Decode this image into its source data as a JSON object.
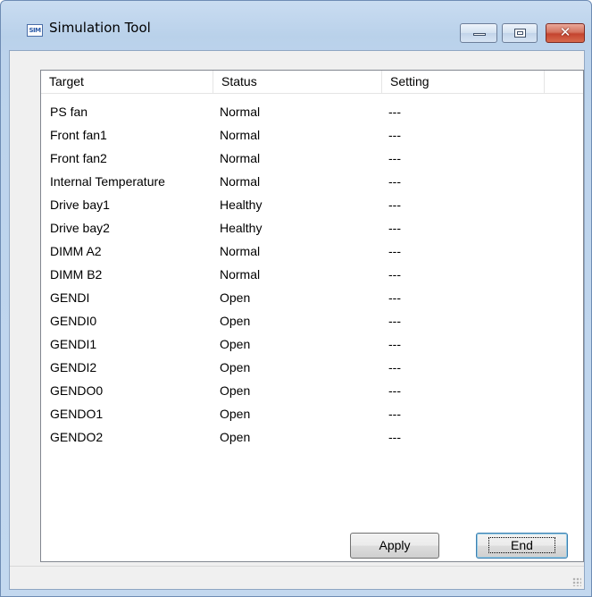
{
  "window": {
    "title": "Simulation Tool",
    "icon_text": "SIM"
  },
  "columns": [
    "Target",
    "Status",
    "Setting"
  ],
  "rows": [
    [
      "PS fan",
      "Normal",
      "---"
    ],
    [
      "Front fan1",
      "Normal",
      "---"
    ],
    [
      "Front fan2",
      "Normal",
      "---"
    ],
    [
      "Internal Temperature",
      "Normal",
      "---"
    ],
    [
      "Drive bay1",
      "Healthy",
      "---"
    ],
    [
      "Drive bay2",
      "Healthy",
      "---"
    ],
    [
      "DIMM A2",
      "Normal",
      "---"
    ],
    [
      "DIMM B2",
      "Normal",
      "---"
    ],
    [
      "GENDI",
      "Open",
      "---"
    ],
    [
      "GENDI0",
      "Open",
      "---"
    ],
    [
      "GENDI1",
      "Open",
      "---"
    ],
    [
      "GENDI2",
      "Open",
      "---"
    ],
    [
      "GENDO0",
      "Open",
      "---"
    ],
    [
      "GENDO1",
      "Open",
      "---"
    ],
    [
      "GENDO2",
      "Open",
      "---"
    ]
  ],
  "buttons": {
    "apply": "Apply",
    "end": "End"
  },
  "caption_buttons": {
    "close_glyph": "✕"
  }
}
